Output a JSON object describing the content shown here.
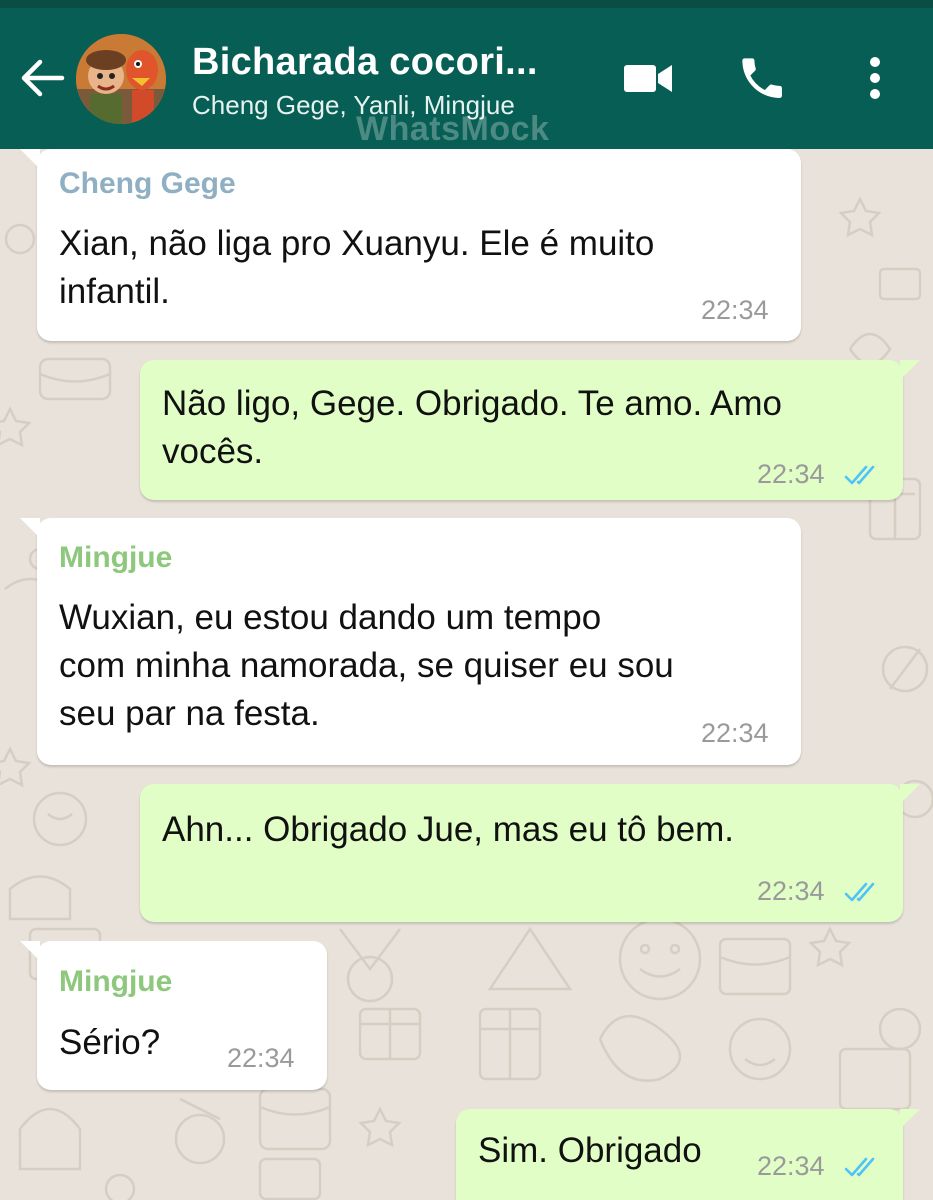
{
  "header": {
    "title": "Bicharada cocori...",
    "members": "Cheng Gege, Yanli, Mingjue",
    "watermark": "WhatsMock",
    "back_icon": "arrow-left-icon",
    "video_icon": "video-camera-icon",
    "call_icon": "phone-icon",
    "menu_icon": "more-vertical-icon",
    "color": "#075e54"
  },
  "colors": {
    "incoming_bubble": "#ffffff",
    "outgoing_bubble": "#e1fec6",
    "sender_cheng": "#8fafc2",
    "sender_mingjue": "#8dc87c",
    "read_ticks": "#4fc3f7"
  },
  "messages": [
    {
      "direction": "in",
      "sender": "Cheng Gege",
      "lines": [
        "Xian, não liga pro Xuanyu. Ele é muito",
        "infantil."
      ],
      "time": "22:34"
    },
    {
      "direction": "out",
      "lines": [
        "Não ligo, Gege. Obrigado. Te amo. Amo",
        "vocês."
      ],
      "time": "22:34",
      "status": "read"
    },
    {
      "direction": "in",
      "sender": "Mingjue",
      "lines": [
        "Wuxian, eu estou dando um tempo",
        "com minha namorada, se quiser eu sou",
        "seu par na festa."
      ],
      "time": "22:34"
    },
    {
      "direction": "out",
      "lines": [
        "Ahn... Obrigado Jue, mas eu tô bem."
      ],
      "time": "22:34",
      "status": "read"
    },
    {
      "direction": "in",
      "sender": "Mingjue",
      "lines": [
        "Sério?"
      ],
      "time": "22:34"
    },
    {
      "direction": "out",
      "lines": [
        "Sim. Obrigado"
      ],
      "time": "22:34",
      "status": "read"
    }
  ]
}
